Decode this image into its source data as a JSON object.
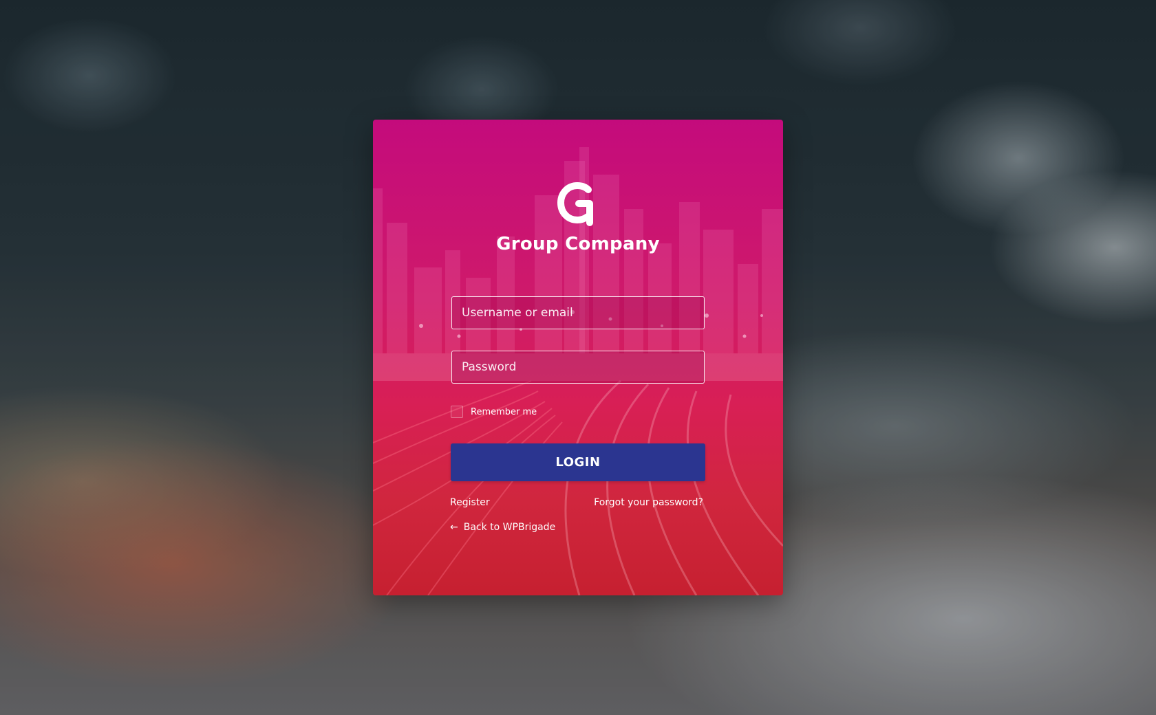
{
  "brand": {
    "name": "Group Company",
    "logo_icon": "g-logo-icon"
  },
  "form": {
    "username_placeholder": "Username or email",
    "password_placeholder": "Password",
    "remember_label": "Remember me",
    "remember_checked": false,
    "login_label": "LOGIN"
  },
  "links": {
    "register": "Register",
    "forgot": "Forgot your password?",
    "back": "Back to WPBrigade",
    "back_icon": "arrow-left-icon"
  },
  "colors": {
    "card_top": "#c40b7c",
    "card_bottom": "#c62030",
    "login_button": "#2b3590",
    "text": "#ffffff"
  }
}
